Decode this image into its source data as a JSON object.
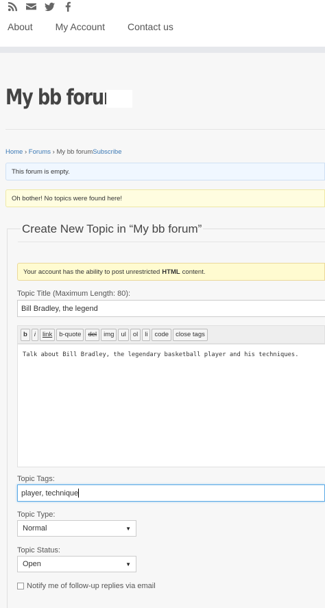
{
  "header": {
    "social_icons": [
      "rss-icon",
      "mail-icon",
      "twitter-icon",
      "facebook-icon"
    ],
    "nav": [
      "About",
      "My Account",
      "Contact us"
    ]
  },
  "site": {
    "title": "My bb forum"
  },
  "breadcrumb": {
    "home": "Home",
    "sep1": " › ",
    "forums": "Forums",
    "sep2": " › ",
    "current": "My bb forum",
    "subscribe": "Subscribe"
  },
  "notices": {
    "empty": "This forum is empty.",
    "no_topics": "Oh bother! No topics were found here!",
    "html_pre": "Your account has the ability to post unrestricted",
    "html_bold": "HTML",
    "html_post": "content."
  },
  "form": {
    "legend": "Create New Topic in “My bb forum”",
    "title_label": "Topic Title (Maximum Length: 80):",
    "title_value": "Bill Bradley, the legend",
    "toolbar": [
      "b",
      "i",
      "link",
      "b-quote",
      "del",
      "img",
      "ul",
      "ol",
      "li",
      "code",
      "close tags"
    ],
    "content": "Talk about Bill Bradley, the legendary basketball player and his techniques.",
    "tags_label": "Topic Tags:",
    "tags_value": "player, technique",
    "type_label": "Topic Type:",
    "type_value": "Normal",
    "status_label": "Topic Status:",
    "status_value": "Open",
    "notify_label": "Notify me of follow-up replies via email"
  },
  "colors": {
    "link": "#3b79b5",
    "info_bg": "#f0f7ff",
    "warn_bg": "#fffde0",
    "focus": "#5aa9e6"
  }
}
